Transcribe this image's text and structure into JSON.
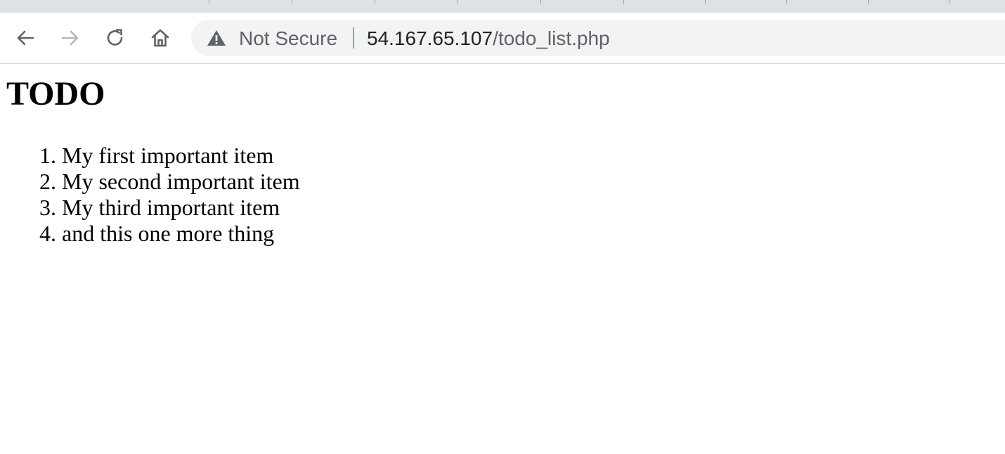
{
  "browser": {
    "security_label": "Not Secure",
    "url_host": "54.167.65.107",
    "url_path": "/todo_list.php",
    "icons": {
      "back": "arrow-left-icon",
      "forward": "arrow-right-icon",
      "reload": "reload-icon",
      "home": "home-icon",
      "security": "warning-triangle-icon"
    }
  },
  "page": {
    "title": "TODO",
    "items": [
      {
        "number": "1.",
        "text": "My first important item"
      },
      {
        "number": "2.",
        "text": "My second important item"
      },
      {
        "number": "3.",
        "text": "My third important item"
      },
      {
        "number": "4.",
        "text": "and this one more thing"
      }
    ]
  }
}
